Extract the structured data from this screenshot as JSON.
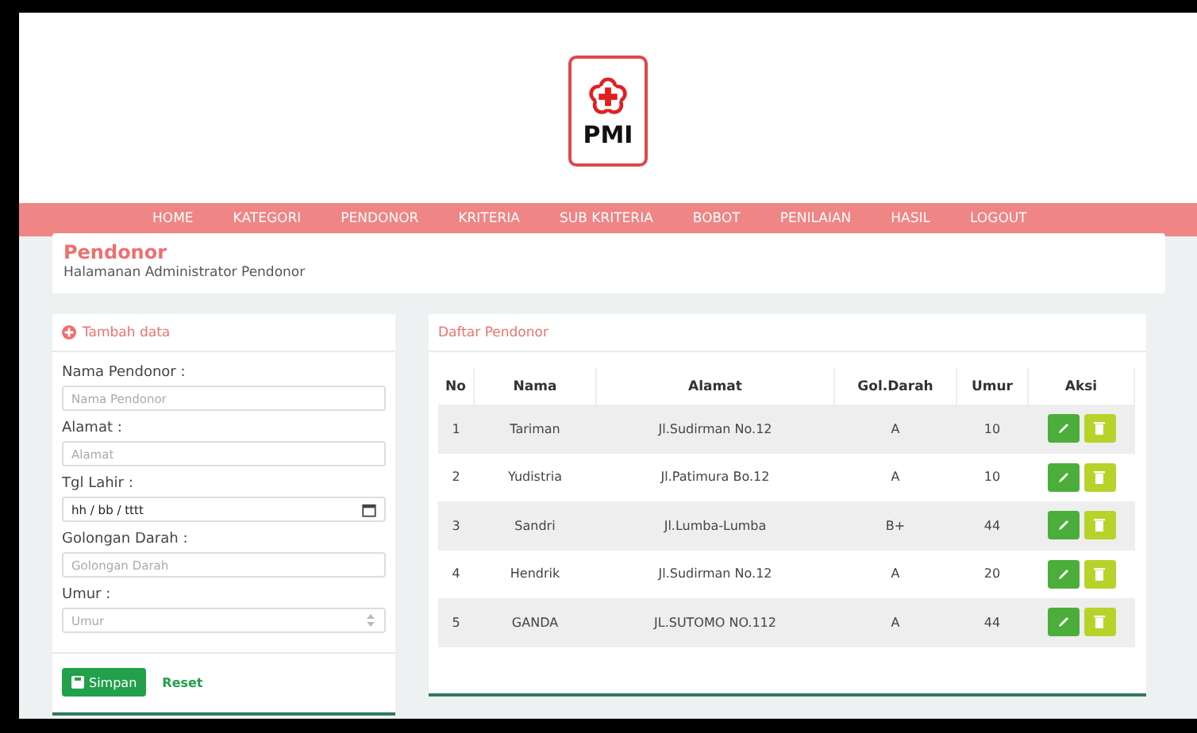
{
  "logo": {
    "text": "PMI"
  },
  "nav": [
    "HOME",
    "KATEGORI",
    "PENDONOR",
    "KRITERIA",
    "SUB KRITERIA",
    "BOBOT",
    "PENILAIAN",
    "HASIL",
    "LOGOUT"
  ],
  "page": {
    "title": "Pendonor",
    "subtitle": "Halamanan Administrator Pendonor"
  },
  "form": {
    "title": "Tambah data",
    "fields": [
      {
        "label": "Nama Pendonor :",
        "kind": "text",
        "placeholder": "Nama Pendonor"
      },
      {
        "label": "Alamat :",
        "kind": "text",
        "placeholder": "Alamat"
      },
      {
        "label": "Tgl Lahir :",
        "kind": "date",
        "value": "hh / bb / tttt"
      },
      {
        "label": "Golongan Darah :",
        "kind": "text",
        "placeholder": "Golongan Darah"
      },
      {
        "label": "Umur :",
        "kind": "number",
        "placeholder": "Umur"
      }
    ],
    "save_button": "Simpan",
    "reset_link": "Reset"
  },
  "table": {
    "title": "Daftar Pendonor",
    "columns": [
      "No",
      "Nama",
      "Alamat",
      "Gol.Darah",
      "Umur",
      "Aksi"
    ],
    "rows": [
      [
        "1",
        "Tariman",
        "Jl.Sudirman No.12",
        "A",
        "10"
      ],
      [
        "2",
        "Yudistria",
        "Jl.Patimura Bo.12",
        "A",
        "10"
      ],
      [
        "3",
        "Sandri",
        "Jl.Lumba-Lumba",
        "B+",
        "44"
      ],
      [
        "4",
        "Hendrik",
        "Jl.Sudirman No.12",
        "A",
        "20"
      ],
      [
        "5",
        "GANDA",
        "JL.SUTOMO NO.112",
        "A",
        "44"
      ]
    ]
  }
}
